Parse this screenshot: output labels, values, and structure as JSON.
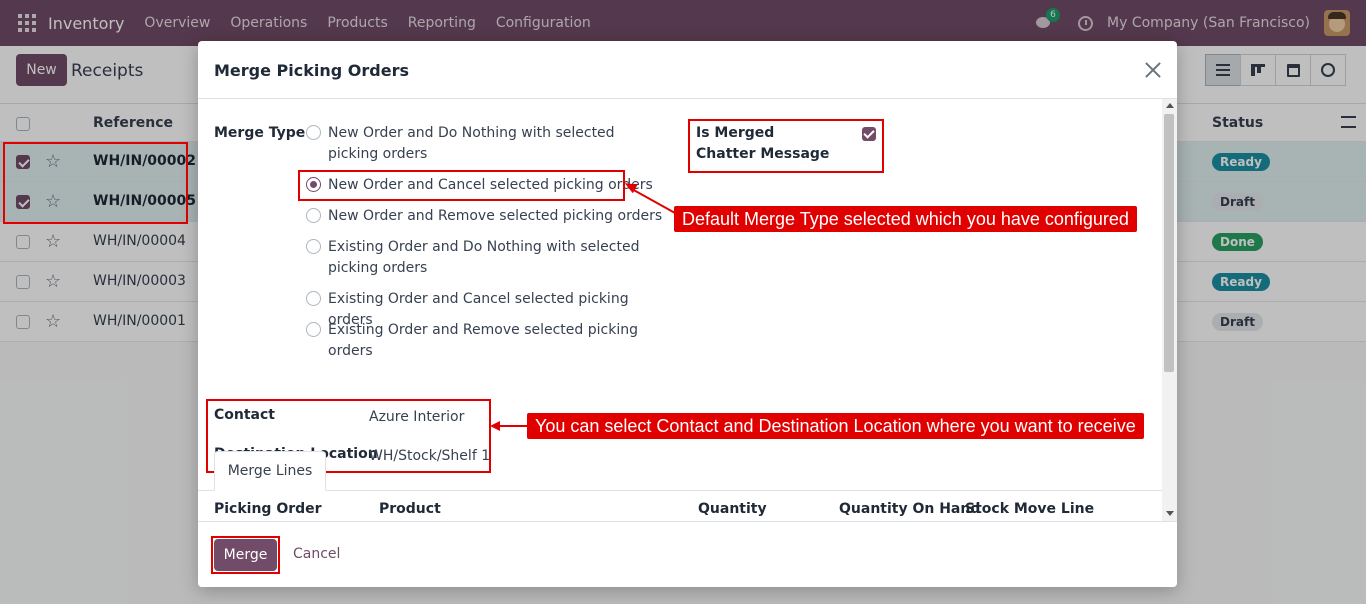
{
  "nav": {
    "app_name": "Inventory",
    "menu": [
      "Overview",
      "Operations",
      "Products",
      "Reporting",
      "Configuration"
    ],
    "chat_count": "6",
    "company": "My Company (San Francisco)"
  },
  "control": {
    "new_label": "New",
    "breadcrumb": "Receipts"
  },
  "list": {
    "headers": {
      "reference": "Reference",
      "status": "Status"
    },
    "rows": [
      {
        "reference": "WH/IN/00002",
        "status": "Ready",
        "selected": true
      },
      {
        "reference": "WH/IN/00005",
        "status": "Draft",
        "selected": true
      },
      {
        "reference": "WH/IN/00004",
        "status": "Done",
        "selected": false
      },
      {
        "reference": "WH/IN/00003",
        "status": "Ready",
        "selected": false
      },
      {
        "reference": "WH/IN/00001",
        "status": "Draft",
        "selected": false
      }
    ]
  },
  "modal": {
    "title": "Merge Picking Orders",
    "merge_type_label": "Merge Type",
    "merge_options": [
      {
        "label": "New Order and Do Nothing with selected picking orders",
        "selected": false
      },
      {
        "label": "New Order and Cancel selected picking orders",
        "selected": true
      },
      {
        "label": "New Order and Remove selected picking orders",
        "selected": false
      },
      {
        "label": "Existing Order and Do Nothing with selected picking orders",
        "selected": false
      },
      {
        "label": "Existing Order and Cancel selected picking orders",
        "selected": false
      },
      {
        "label": "Existing Order and Remove selected picking orders",
        "selected": false
      }
    ],
    "chatter_label": "Is Merged Chatter Message",
    "chatter_checked": true,
    "contact_label": "Contact",
    "contact_value": "Azure Interior",
    "dest_label": "Destination Location",
    "dest_value": "WH/Stock/Shelf 1",
    "tab_label": "Merge Lines",
    "columns": [
      "Picking Order",
      "Product",
      "Quantity",
      "Quantity On Hand",
      "Stock Move Line"
    ],
    "merge_button": "Merge",
    "cancel_button": "Cancel"
  },
  "annotations": {
    "merge_type_note": "Default Merge Type selected which you have configured",
    "contact_note": "You can select Contact and Destination Location where you want to receive"
  },
  "colors": {
    "brand": "#714b67",
    "annotation": "#e00000",
    "ready": "#1b8fa3",
    "done": "#28a063"
  }
}
